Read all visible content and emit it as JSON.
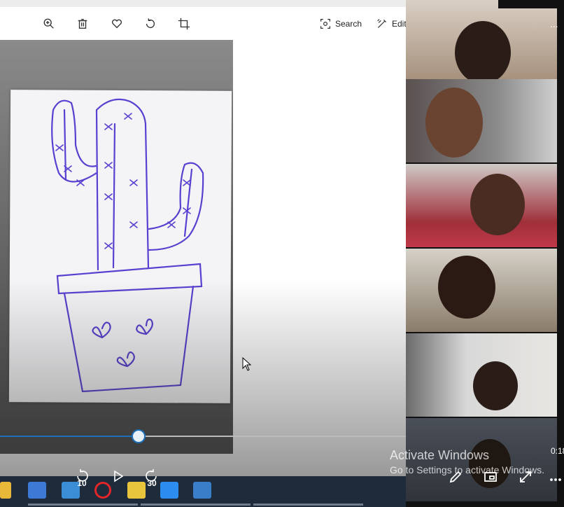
{
  "toolbar": {
    "search_label": "Search",
    "edit_label": "Edit",
    "more_label": "..."
  },
  "icons": {
    "zoom": "zoom-in-icon",
    "delete": "trash-icon",
    "favorite": "heart-icon",
    "rotate": "rotate-icon",
    "crop": "crop-icon"
  },
  "player": {
    "rewind_label": "10",
    "forward_label": "30",
    "progress": 0.34,
    "timecode": "0:18"
  },
  "watermark": {
    "line1": "Activate Windows",
    "line2": "Go to Settings to activate Windows."
  },
  "colors": {
    "accent": "#1d6fb8",
    "drawing_ink": "#5a3fd0",
    "taskbar": "#1e2b3a"
  },
  "gallery_tile_count": 6
}
